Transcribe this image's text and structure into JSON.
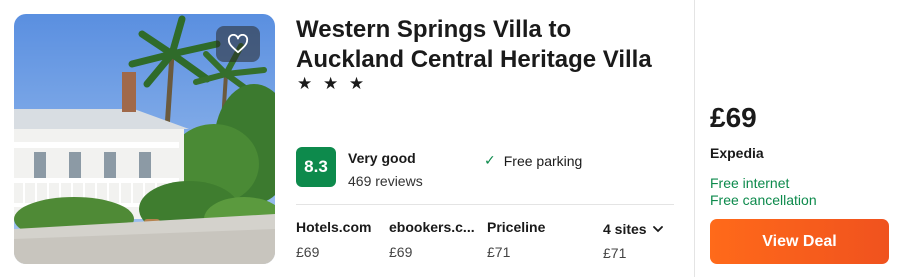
{
  "listing": {
    "title": "Western Springs Villa to Auckland Central Heritage Villa",
    "stars": "★ ★ ★",
    "photo_alt": "villa-photo"
  },
  "rating": {
    "score": "8.3",
    "label": "Very good",
    "reviews": "469 reviews"
  },
  "amenities": [
    {
      "icon": "check-icon",
      "label": "Free parking"
    }
  ],
  "sites": [
    {
      "name": "Hotels.com",
      "price": "£69"
    },
    {
      "name": "ebookers.c...",
      "price": "£69"
    },
    {
      "name": "Priceline",
      "price": "£71"
    }
  ],
  "more_sites": {
    "label": "4 sites",
    "price": "£71",
    "icon": "chevron-down-icon"
  },
  "deal": {
    "price": "£69",
    "provider": "Expedia",
    "perks": [
      "Free internet",
      "Free cancellation"
    ],
    "button_label": "View Deal"
  },
  "colors": {
    "score_bg": "#0d8a4c",
    "perk_text": "#0d8a4c",
    "deal_button": "#f05a1e"
  }
}
